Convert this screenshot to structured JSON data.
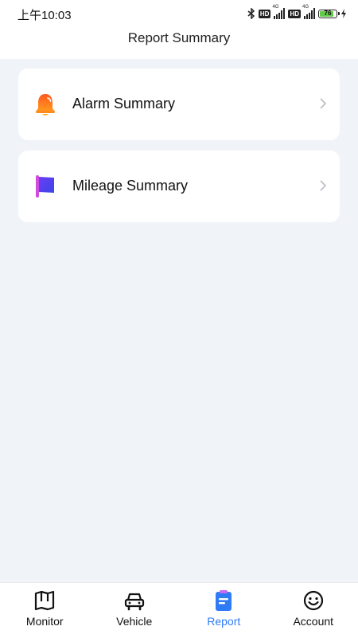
{
  "status_bar": {
    "time": "上午10:03",
    "hd_badge": "HD",
    "network": "4G",
    "battery_level": "76"
  },
  "header": {
    "title": "Report Summary"
  },
  "menu": {
    "items": [
      {
        "label": "Alarm Summary",
        "icon": "bell-icon"
      },
      {
        "label": "Mileage Summary",
        "icon": "flag-icon"
      }
    ]
  },
  "tabbar": {
    "active": "Report",
    "accent_color": "#2f7bf5",
    "tabs": [
      {
        "label": "Monitor",
        "icon": "map-icon"
      },
      {
        "label": "Vehicle",
        "icon": "car-icon"
      },
      {
        "label": "Report",
        "icon": "report-icon"
      },
      {
        "label": "Account",
        "icon": "smiley-icon"
      }
    ]
  }
}
